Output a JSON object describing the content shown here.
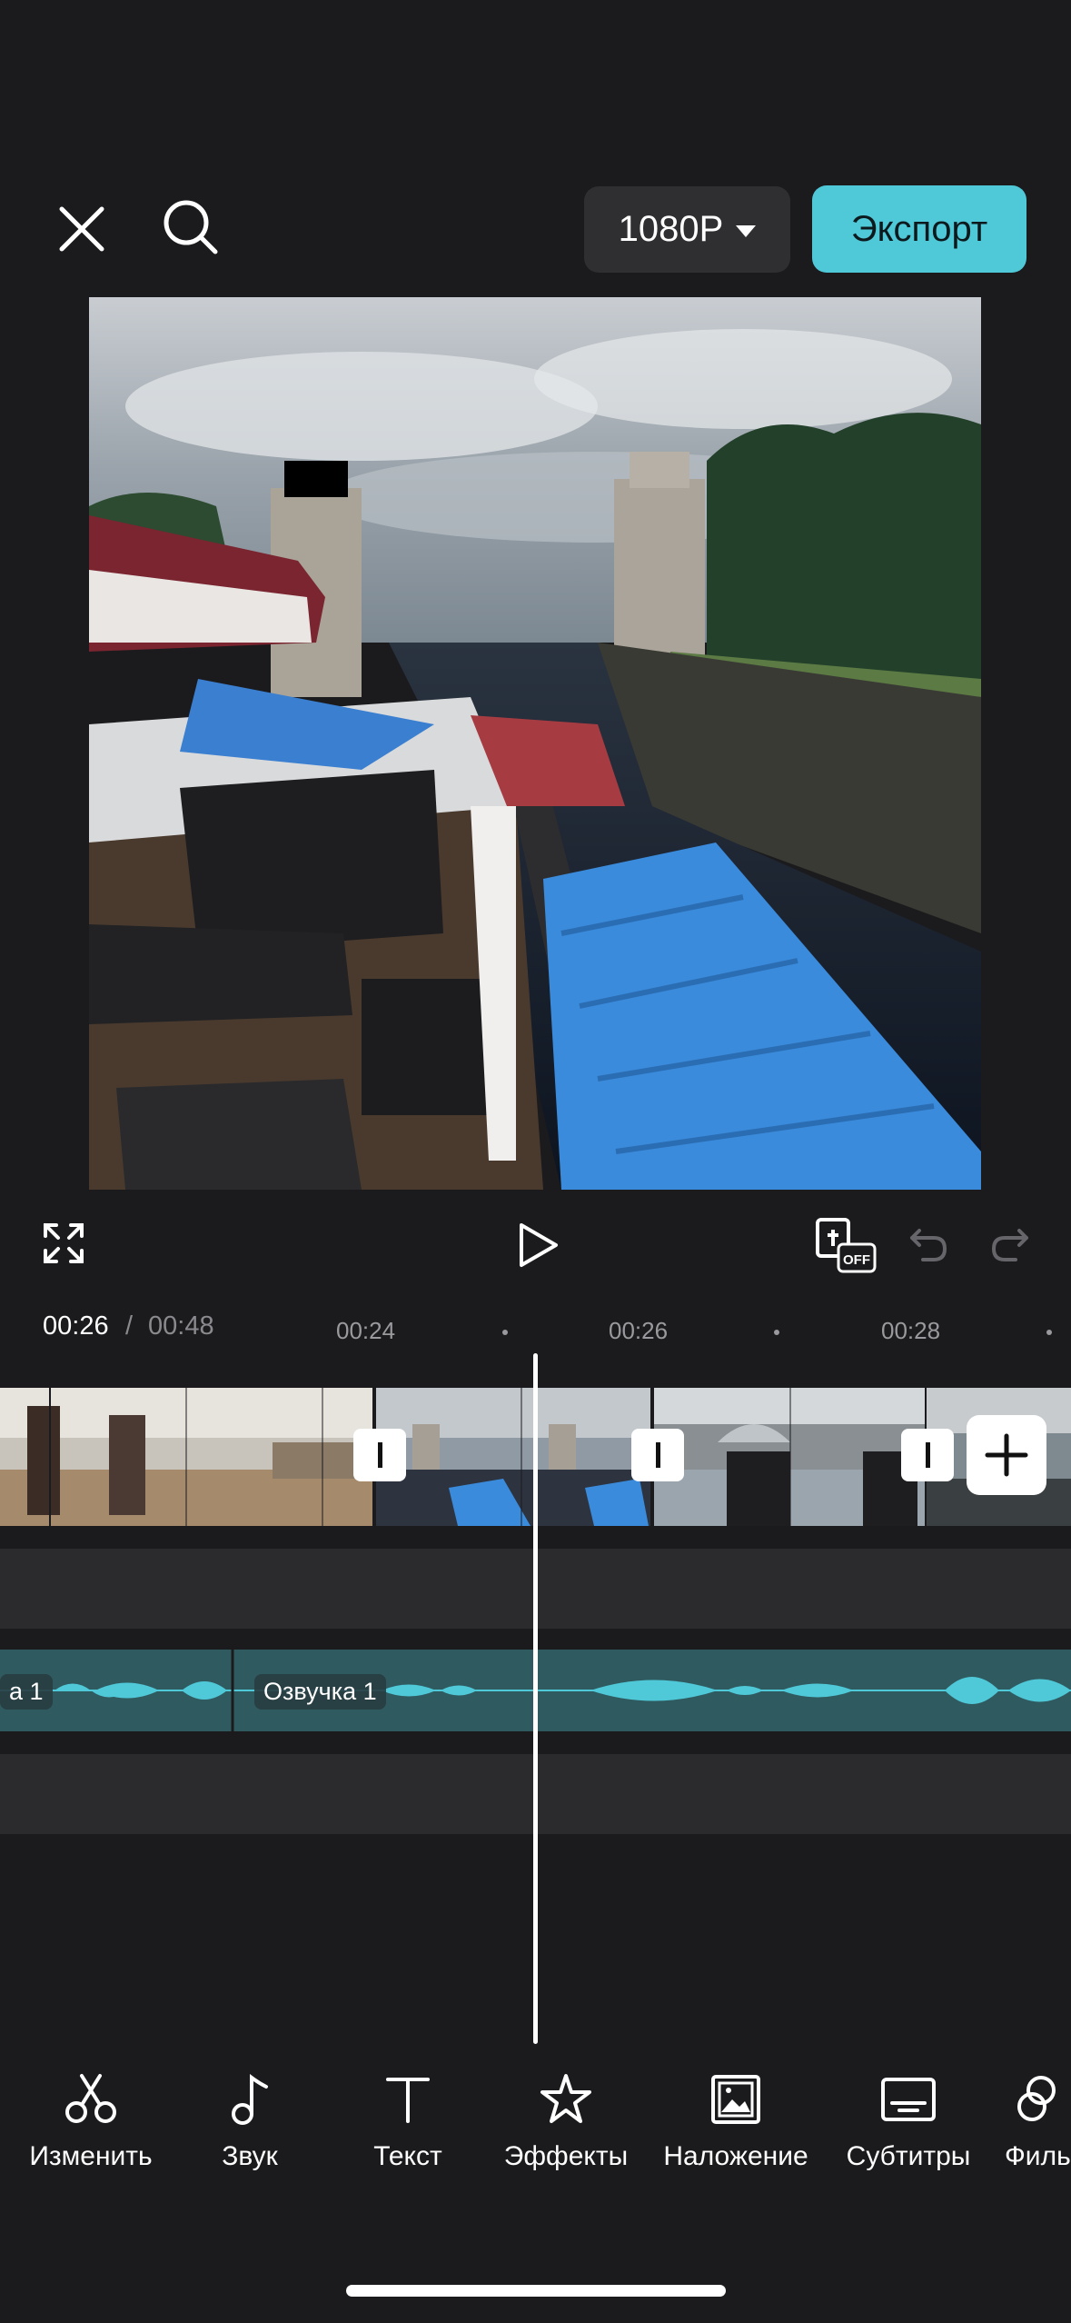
{
  "header": {
    "resolution_label": "1080P",
    "export_label": "Экспорт"
  },
  "timeline": {
    "current_time": "00:26",
    "separator": "/",
    "total_time": "00:48",
    "ruler_ticks": [
      "00:24",
      "00:26",
      "00:28"
    ]
  },
  "audio": {
    "clip_labels": [
      "а 1",
      "Озвучка 1"
    ]
  },
  "toolbar": {
    "items": [
      {
        "label": "Изменить",
        "icon": "scissors-icon"
      },
      {
        "label": "Звук",
        "icon": "music-note-icon"
      },
      {
        "label": "Текст",
        "icon": "text-icon"
      },
      {
        "label": "Эффекты",
        "icon": "star-effects-icon"
      },
      {
        "label": "Наложение",
        "icon": "overlay-image-icon"
      },
      {
        "label": "Субтитры",
        "icon": "subtitles-icon"
      },
      {
        "label": "Филь",
        "icon": "filters-icon"
      }
    ]
  },
  "colors": {
    "accent": "#4fc8d8",
    "background": "#1b1b1d",
    "audio_track": "#2f5b60"
  }
}
